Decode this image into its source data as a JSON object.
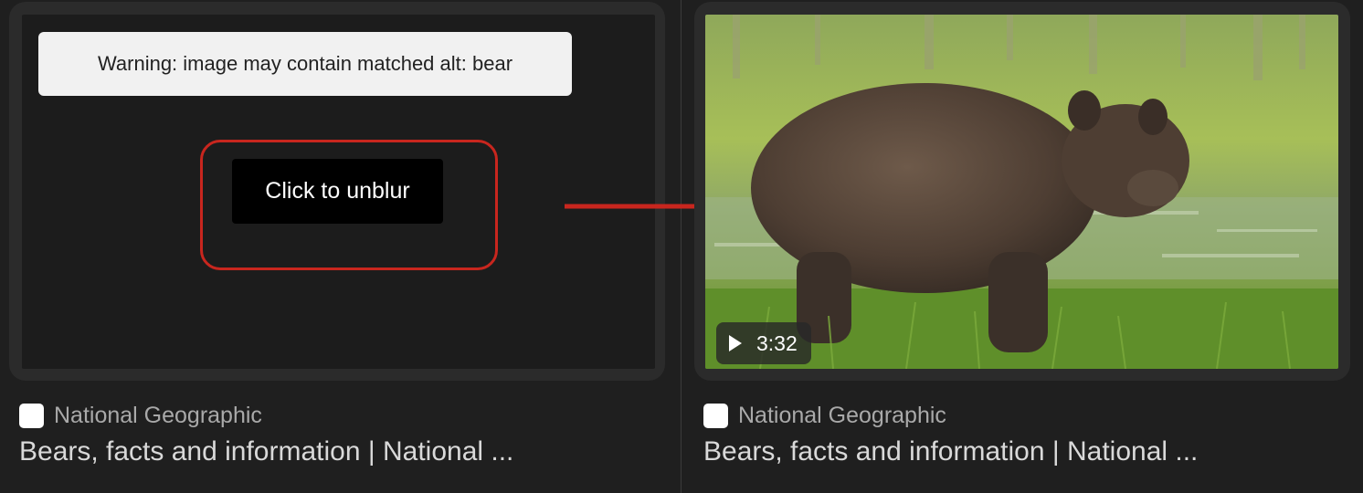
{
  "left_card": {
    "warning_text": "Warning: image may contain matched alt: bear",
    "unblur_label": "Click to unblur",
    "source_name": "National Geographic",
    "title": "Bears, facts and information | National ..."
  },
  "right_card": {
    "duration": "3:32",
    "source_name": "National Geographic",
    "title": "Bears, facts and information | National ..."
  },
  "colors": {
    "background": "#1f1f1f",
    "highlight": "#c8261e"
  }
}
